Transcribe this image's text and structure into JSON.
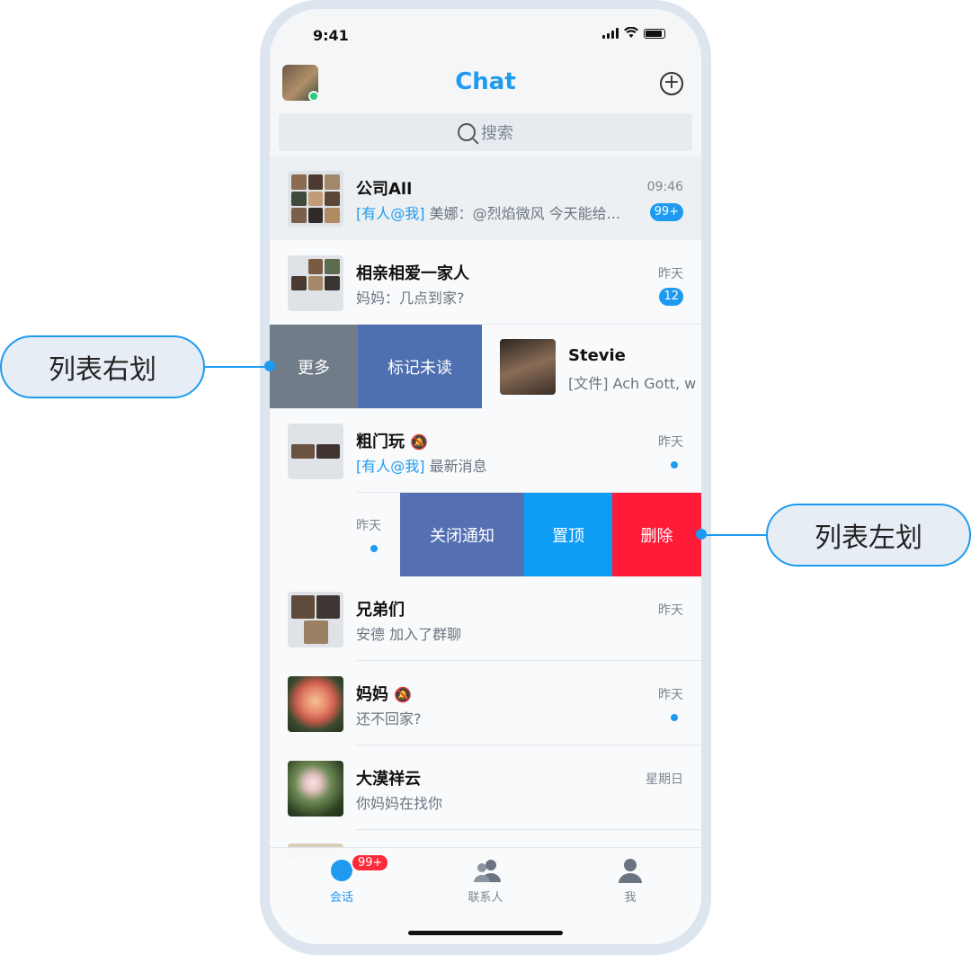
{
  "status": {
    "time": "9:41"
  },
  "header": {
    "title": "Chat"
  },
  "search": {
    "placeholder": "搜索"
  },
  "chats": [
    {
      "name": "公司All",
      "at": "[有人@我]",
      "preview": " 美娜：@烈焰微风 今天能给...",
      "time": "09:46",
      "badge": "99+"
    },
    {
      "name": "相亲相爱一家人",
      "preview": "妈妈：几点到家?",
      "time": "昨天",
      "badge": "12"
    },
    {
      "name": "粗门玩",
      "at": "[有人@我]",
      "preview": " 最新消息",
      "time": "昨天"
    },
    {
      "name": "兄弟们",
      "preview": "安德 加入了群聊",
      "time": "昨天"
    },
    {
      "name": "妈妈",
      "preview": "还不回家?",
      "time": "昨天"
    },
    {
      "name": "大漠祥云",
      "preview": "你妈妈在找你",
      "time": "星期日"
    }
  ],
  "swipe_right": {
    "more": "更多",
    "mark_unread": "标记未读",
    "name": "Stevie",
    "preview": "[文件] Ach Gott, w"
  },
  "swipe_left": {
    "time": "昨天",
    "close_notify": "关闭通知",
    "pin": "置顶",
    "delete": "删除"
  },
  "tabbar": {
    "chat": "会话",
    "chat_badge": "99+",
    "contacts": "联系人",
    "me": "我"
  },
  "callouts": {
    "right_swipe": "列表右划",
    "left_swipe": "列表左划"
  },
  "colors": {
    "accent": "#1e9bf0",
    "more": "#707c87",
    "mark_unread": "#4e6fb0",
    "close_notify": "#5470b2",
    "pin": "#0f9cf5",
    "delete": "#ff1a38"
  }
}
